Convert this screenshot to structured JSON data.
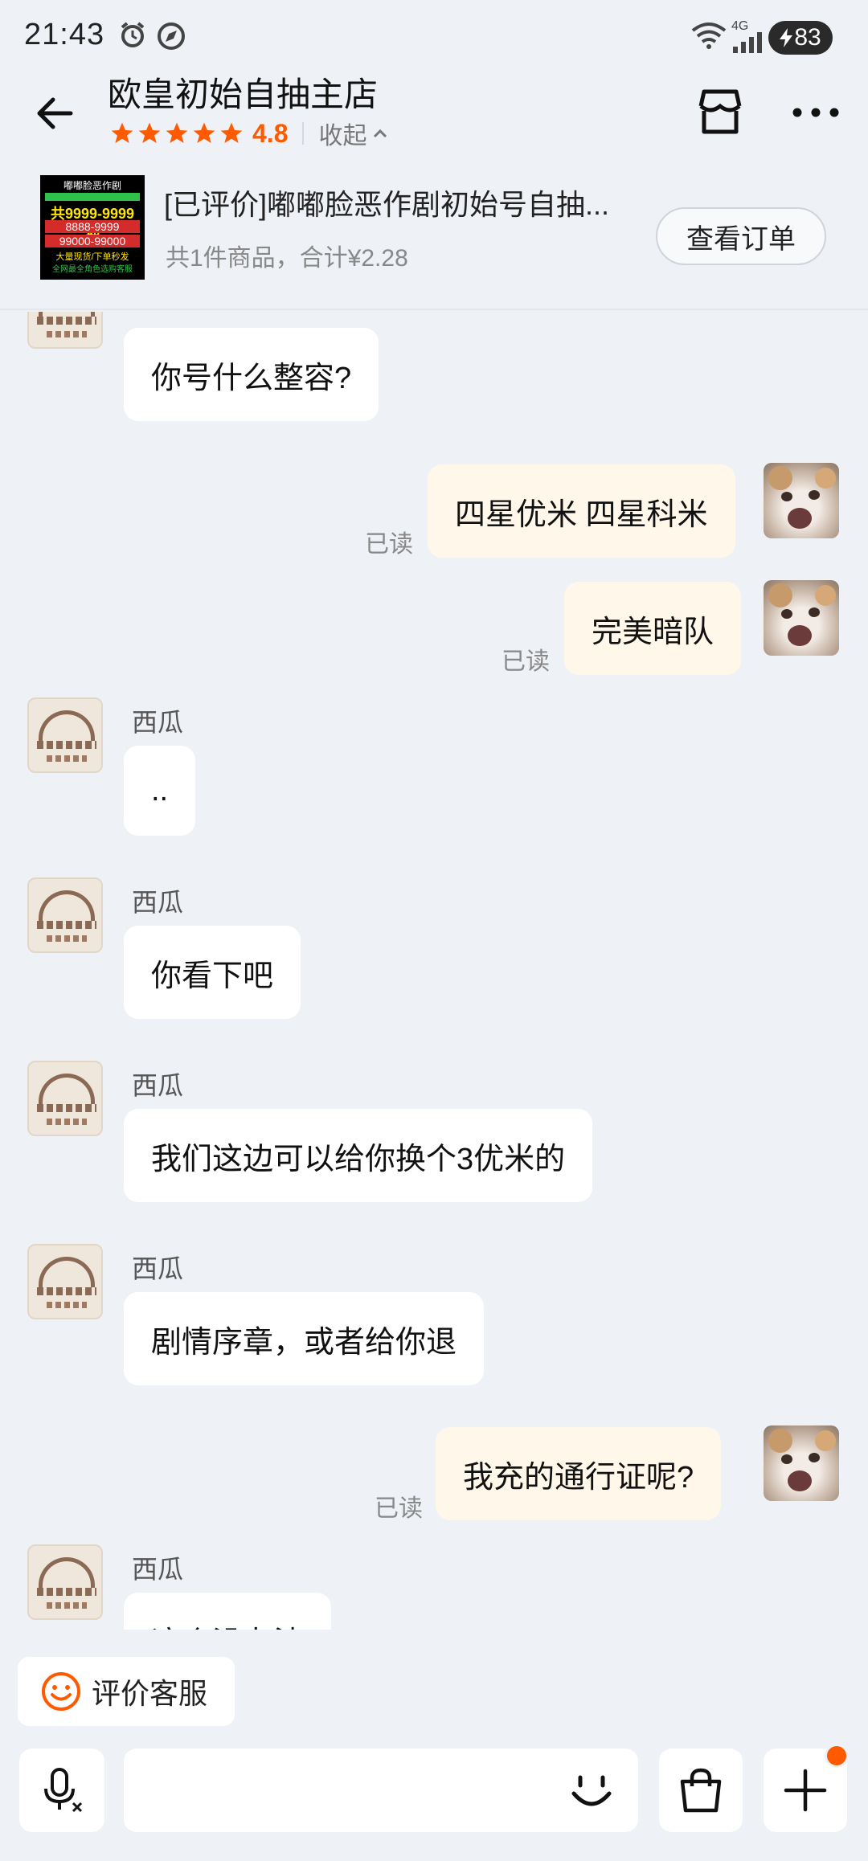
{
  "status_bar": {
    "time": "21:43",
    "battery": "83",
    "network": "4G"
  },
  "header": {
    "shop_name": "欧皇初始自抽主店",
    "rating": "4.8",
    "collapse_label": "收起"
  },
  "order": {
    "product_name": "[已评价]嘟嘟脸恶作剧初始号自抽...",
    "summary": "共1件商品，合计¥2.28",
    "view_order_label": "查看订单",
    "thumbnail_text": {
      "line1": "嘟嘟脸恶作剧",
      "line3": "共9999-9999抽",
      "line4": "8888-9999",
      "line5": "99000-99000",
      "line6": "大量现货/下单秒发",
      "line7": "全网最全角色选购客服"
    }
  },
  "messages": [
    {
      "side": "in",
      "sender": "",
      "text": "你号什么整容?"
    },
    {
      "side": "out",
      "text": "四星优米 四星科米",
      "read": "已读"
    },
    {
      "side": "out",
      "text": "完美暗队",
      "read": "已读"
    },
    {
      "side": "in",
      "sender": "西瓜",
      "text": ".."
    },
    {
      "side": "in",
      "sender": "西瓜",
      "text": "你看下吧"
    },
    {
      "side": "in",
      "sender": "西瓜",
      "text": "我们这边可以给你换个3优米的"
    },
    {
      "side": "in",
      "sender": "西瓜",
      "text": "剧情序章，或者给你退"
    },
    {
      "side": "out",
      "text": "我充的通行证呢?",
      "read": "已读"
    },
    {
      "side": "in",
      "sender": "西瓜",
      "text": "这个没办法"
    }
  ],
  "rate_service": {
    "label": "评价客服"
  },
  "input": {
    "placeholder": ""
  },
  "colors": {
    "accent": "#ff5a00",
    "background": "#eef1f6",
    "outgoing_bubble": "#fff7ea"
  }
}
